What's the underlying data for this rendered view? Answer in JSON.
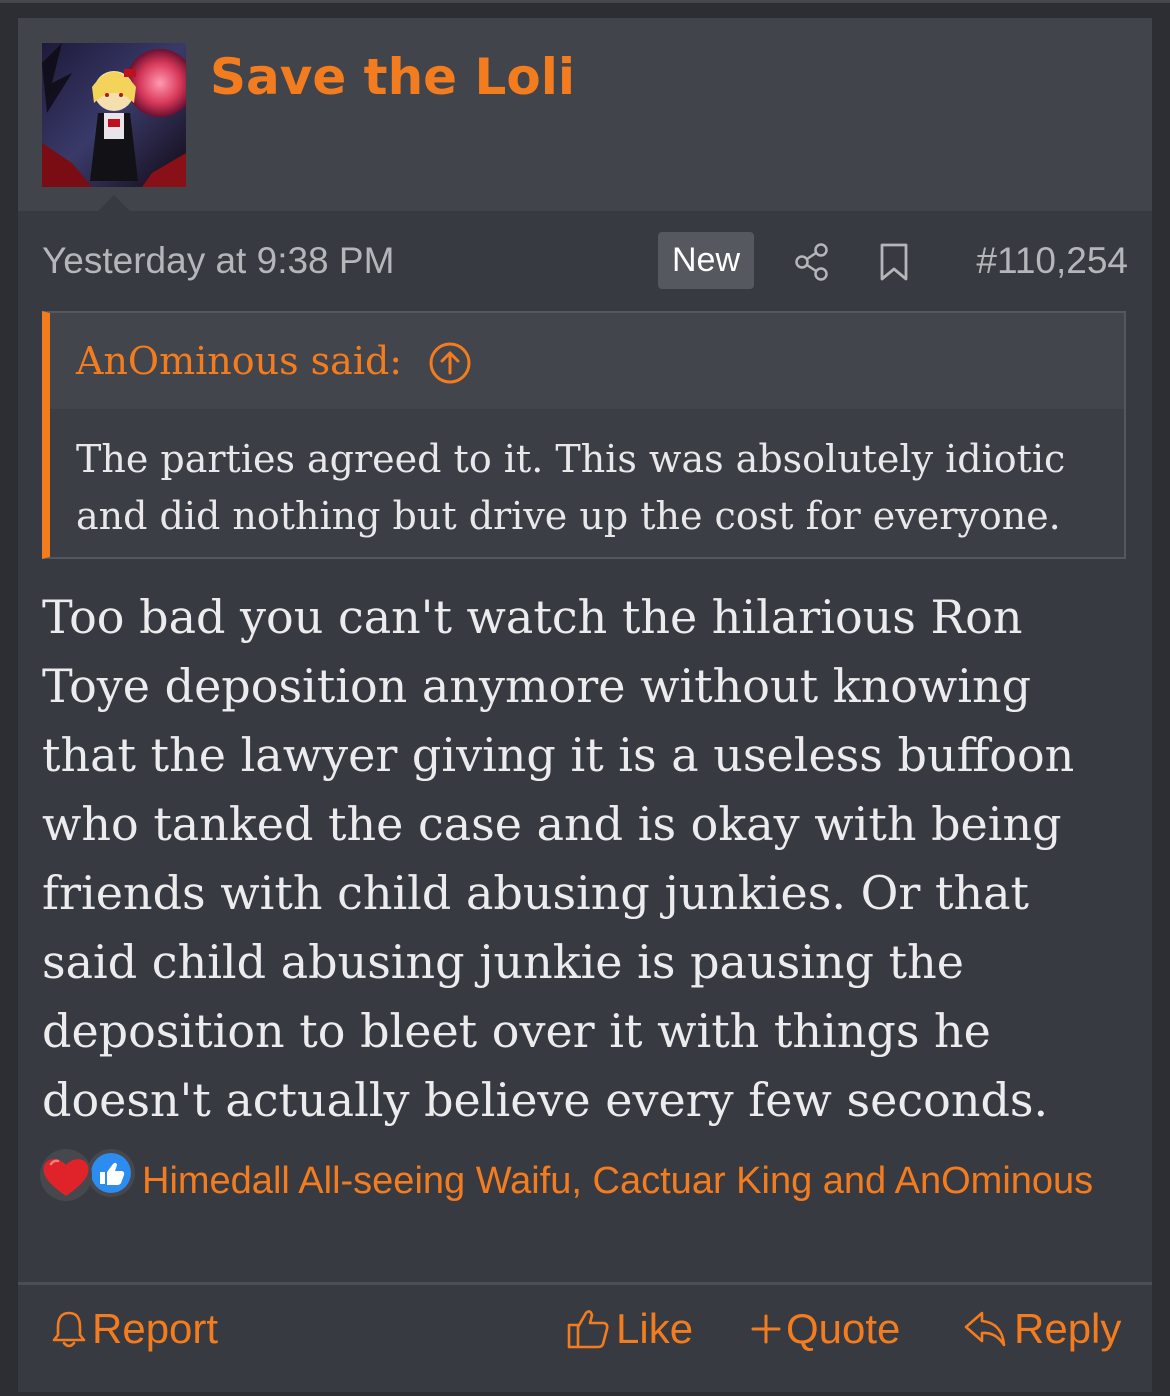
{
  "post": {
    "username": "Save the Loli",
    "timestamp": "Yesterday at 9:38 PM",
    "new_badge": "New",
    "post_number": "#110,254"
  },
  "quote": {
    "author": "AnOminous said:",
    "text": "The parties agreed to it. This was absolutely idiotic and did nothing but drive up the cost for everyone."
  },
  "message": {
    "text": "Too bad you can't watch the hilarious Ron Toye deposition anymore without knowing that the lawyer giving it is a useless buffoon who tanked the case and is okay with being friends with child abusing junkies. Or that said child abusing junkie is pausing the deposition to bleet over it with things he doesn't actually believe every few seconds."
  },
  "reactions": {
    "icons": [
      "heart-icon",
      "thumbs-up-icon"
    ],
    "text": "Himedall All-seeing Waifu, Cactuar King and AnOminous"
  },
  "footer": {
    "report": "Report",
    "like": "Like",
    "quote": "Quote",
    "reply": "Reply"
  },
  "colors": {
    "accent": "#f37c1f",
    "background": "#383a41",
    "header": "#41444b"
  }
}
